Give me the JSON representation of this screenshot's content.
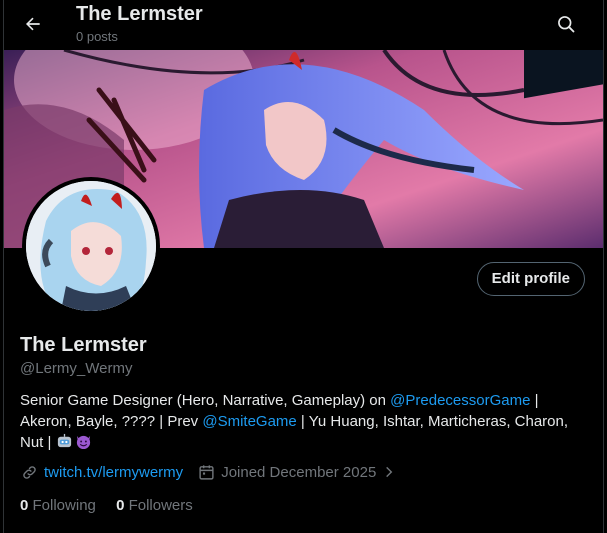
{
  "header": {
    "title": "The Lermster",
    "posts_count": "0 posts",
    "back_icon": "arrow-left-icon",
    "search_icon": "search-icon"
  },
  "profile": {
    "edit_button": "Edit profile",
    "name": "The Lermster",
    "handle": "@Lermy_Wermy",
    "bio": {
      "part1": "Senior Game Designer (Hero, Narrative, Gameplay) on ",
      "mention1": "@PredecessorGame",
      "part2": " | Akeron, Bayle, ???? | Prev ",
      "mention2": "@SmiteGame",
      "part3": " | Yu Huang, Ishtar, Marticheras, Charon, Nut | "
    },
    "link": "twitch.tv/lermywermy",
    "joined": "Joined December 2025",
    "following_count": "0",
    "following_label": "Following",
    "followers_count": "0",
    "followers_label": "Followers"
  },
  "colors": {
    "accent": "#1d9bf0",
    "muted": "#71767b",
    "text": "#e7e9ea"
  }
}
